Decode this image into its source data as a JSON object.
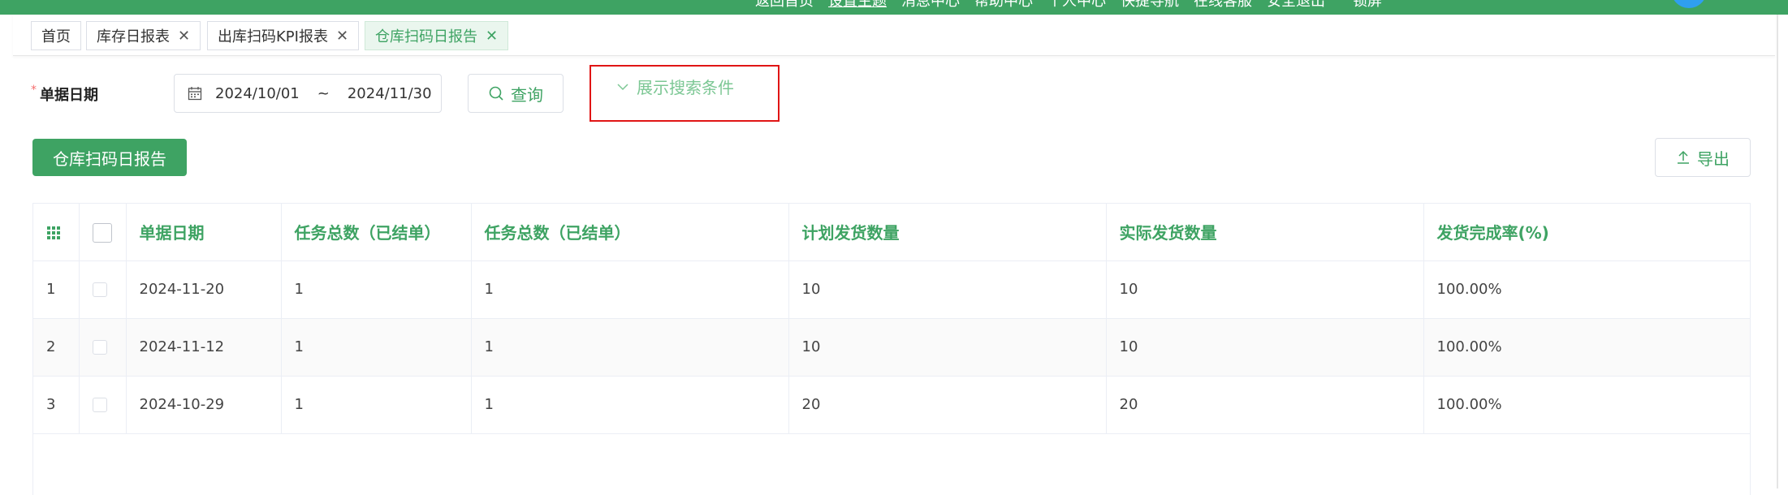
{
  "header": {
    "nav": [
      "返回首页",
      "设置主题",
      "消息中心",
      "帮助中心",
      "个人中心",
      "快捷导航",
      "在线客服",
      "安全退出",
      "锁屏"
    ],
    "colors": {
      "brand": "#3ea363",
      "highlight": "#e01515"
    }
  },
  "tabs": [
    {
      "label": "首页",
      "closable": false,
      "active": false
    },
    {
      "label": "库存日报表",
      "closable": true,
      "active": false
    },
    {
      "label": "出库扫码KPI报表",
      "closable": true,
      "active": false
    },
    {
      "label": "仓库扫码日报告",
      "closable": true,
      "active": true
    }
  ],
  "search": {
    "date_label": "单据日期",
    "required_mark": "*",
    "start_date": "2024/10/01",
    "range_separator": "~",
    "end_date": "2024/11/30",
    "query_label": "查询",
    "toggle_label": "展示搜索条件"
  },
  "actions": {
    "report_button": "仓库扫码日报告",
    "export_button": "导出"
  },
  "table": {
    "headers": [
      "单据日期",
      "任务总数（已结单）",
      "任务总数（已结单）",
      "计划发货数量",
      "实际发货数量",
      "发货完成率(%)"
    ],
    "rows": [
      {
        "index": "1",
        "date": "2024-11-20",
        "tasks_a": "1",
        "tasks_b": "1",
        "planned": "10",
        "actual": "10",
        "rate": "100.00%"
      },
      {
        "index": "2",
        "date": "2024-11-12",
        "tasks_a": "1",
        "tasks_b": "1",
        "planned": "10",
        "actual": "10",
        "rate": "100.00%"
      },
      {
        "index": "3",
        "date": "2024-10-29",
        "tasks_a": "1",
        "tasks_b": "1",
        "planned": "20",
        "actual": "20",
        "rate": "100.00%"
      }
    ]
  }
}
